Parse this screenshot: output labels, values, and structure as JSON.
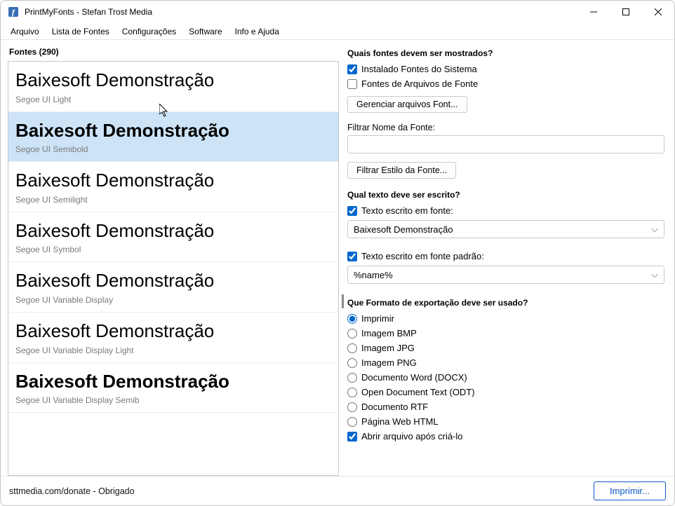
{
  "window": {
    "title": "PrintMyFonts - Stefan Trost Media"
  },
  "menu": {
    "file": "Arquivo",
    "fontlist": "Lista de Fontes",
    "config": "Configurações",
    "software": "Software",
    "info": "Info e Ajuda"
  },
  "left": {
    "header": "Fontes (290)",
    "items": [
      {
        "sample": "Baixesoft Demonstração",
        "name": "Segoe UI Light",
        "weight": "300",
        "selected": false
      },
      {
        "sample": "Baixesoft Demonstração",
        "name": "Segoe UI Semibold",
        "weight": "600",
        "selected": true
      },
      {
        "sample": "Baixesoft Demonstração",
        "name": "Segoe UI Semilight",
        "weight": "350",
        "selected": false
      },
      {
        "sample": "Baixesoft Demonstração",
        "name": "Segoe UI Symbol",
        "weight": "400",
        "selected": false
      },
      {
        "sample": "Baixesoft Demonstração",
        "name": "Segoe UI Variable Display",
        "weight": "400",
        "selected": false
      },
      {
        "sample": "Baixesoft Demonstração",
        "name": "Segoe UI Variable Display Light",
        "weight": "300",
        "selected": false
      },
      {
        "sample": "Baixesoft Demonstração",
        "name": "Segoe UI Variable Display Semib",
        "weight": "700",
        "selected": false
      }
    ]
  },
  "right": {
    "q1_title": "Quais fontes devem ser mostrados?",
    "chk_installed": "Instalado Fontes do Sistema",
    "chk_files": "Fontes de Arquivos de Fonte",
    "btn_manage": "Gerenciar arquivos Font...",
    "filter_name_label": "Filtrar Nome da Fonte:",
    "filter_name_value": "",
    "btn_filter_style": "Filtrar Estilo da Fonte...",
    "q2_title": "Qual texto deve ser escrito?",
    "chk_text_font": "Texto escrito em fonte:",
    "combo_text_font": "Baixesoft Demonstração",
    "chk_text_std": "Texto escrito em fonte padrão:",
    "combo_text_std": "%name%",
    "q3_title": "Que Formato de exportação deve ser usado?",
    "radio_print": "Imprimir",
    "radio_bmp": "Imagem BMP",
    "radio_jpg": "Imagem JPG",
    "radio_png": "Imagem PNG",
    "radio_docx": "Documento Word (DOCX)",
    "radio_odt": "Open Document Text (ODT)",
    "radio_rtf": "Documento RTF",
    "radio_html": "Página Web HTML",
    "chk_open_after": "Abrir arquivo após criá-lo"
  },
  "status": {
    "text": "sttmedia.com/donate - Obrigado",
    "print_btn": "Imprimir..."
  }
}
